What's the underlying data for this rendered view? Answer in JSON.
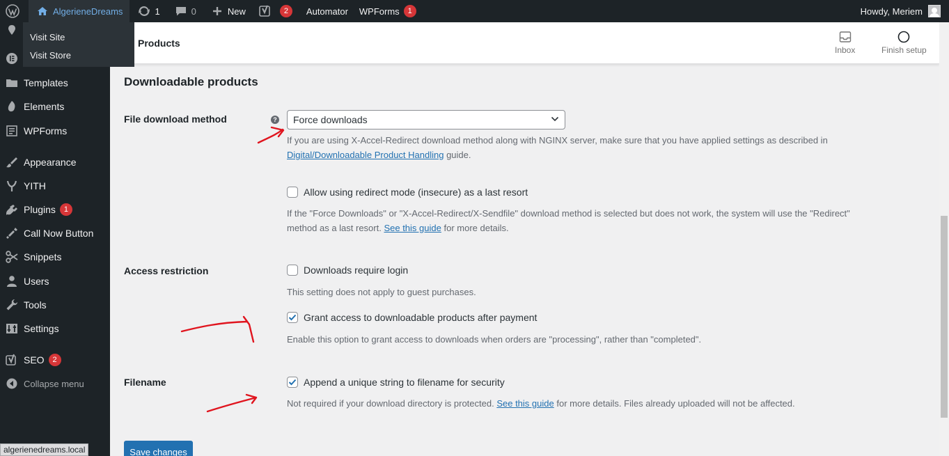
{
  "adminbar": {
    "site_name": "AlgerieneDreams",
    "updates_count": "1",
    "comments_count": "0",
    "new_label": "New",
    "yoast_count": "2",
    "automator_label": "Automator",
    "wpforms_label": "WPForms",
    "wpforms_count": "1",
    "howdy": "Howdy, Meriem"
  },
  "site_dropdown": {
    "items": [
      {
        "label": "Visit Site"
      },
      {
        "label": "Visit Store"
      }
    ]
  },
  "sidebar": {
    "items": [
      {
        "label": "Templates",
        "icon": "folder-icon"
      },
      {
        "label": "Elements",
        "icon": "elements-icon"
      },
      {
        "label": "WPForms",
        "icon": "wpforms-icon"
      },
      {
        "label": "Appearance",
        "icon": "paintbrush-icon"
      },
      {
        "label": "YITH",
        "icon": "yith-icon"
      },
      {
        "label": "Plugins",
        "icon": "plugin-icon",
        "badge": "1"
      },
      {
        "label": "Call Now Button",
        "icon": "phone-icon"
      },
      {
        "label": "Snippets",
        "icon": "scissors-icon"
      },
      {
        "label": "Users",
        "icon": "user-icon"
      },
      {
        "label": "Tools",
        "icon": "wrench-icon"
      },
      {
        "label": "Settings",
        "icon": "settings-icon"
      },
      {
        "label": "SEO",
        "icon": "yoast-icon",
        "badge": "2"
      },
      {
        "label": "Collapse menu",
        "icon": "collapse-icon"
      }
    ]
  },
  "status_url": "algerienedreams.local",
  "header": {
    "title": "Products",
    "inbox_label": "Inbox",
    "finish_setup_label": "Finish setup"
  },
  "main": {
    "section_title": "Downloadable products",
    "download_method": {
      "label": "File download method",
      "help_glyph": "?",
      "selected": "Force downloads",
      "desc_before": "If you are using X-Accel-Redirect download method along with NGINX server, make sure that you have applied settings as described in",
      "desc_link": "Digital/Downloadable Product Handling",
      "desc_after": " guide."
    },
    "redirect_fallback": {
      "label": "Allow using redirect mode (insecure) as a last resort",
      "checked": false,
      "desc_line1": "If the \"Force Downloads\" or \"X-Accel-Redirect/X-Sendfile\" download method is selected but does not work, the system will use the \"Redirect\"",
      "desc_line2_before": "method as a last resort. ",
      "desc_link": "See this guide",
      "desc_line2_after": " for more details."
    },
    "access_restriction": {
      "label": "Access restriction",
      "require_login_label": "Downloads require login",
      "require_login_checked": false,
      "require_login_desc": "This setting does not apply to guest purchases.",
      "grant_access_label": "Grant access to downloadable products after payment",
      "grant_access_checked": true,
      "grant_access_desc": "Enable this option to grant access to downloads when orders are \"processing\", rather than \"completed\"."
    },
    "filename": {
      "label": "Filename",
      "append_label": "Append a unique string to filename for security",
      "append_checked": true,
      "desc_before": "Not required if your download directory is protected. ",
      "desc_link": "See this guide",
      "desc_after": " for more details. Files already uploaded will not be affected."
    },
    "save_label": "Save changes"
  },
  "colors": {
    "admin_bar": "#1d2327",
    "accent_blue": "#2271b1",
    "badge_red": "#d63638",
    "annotation_red": "#e0141e"
  }
}
